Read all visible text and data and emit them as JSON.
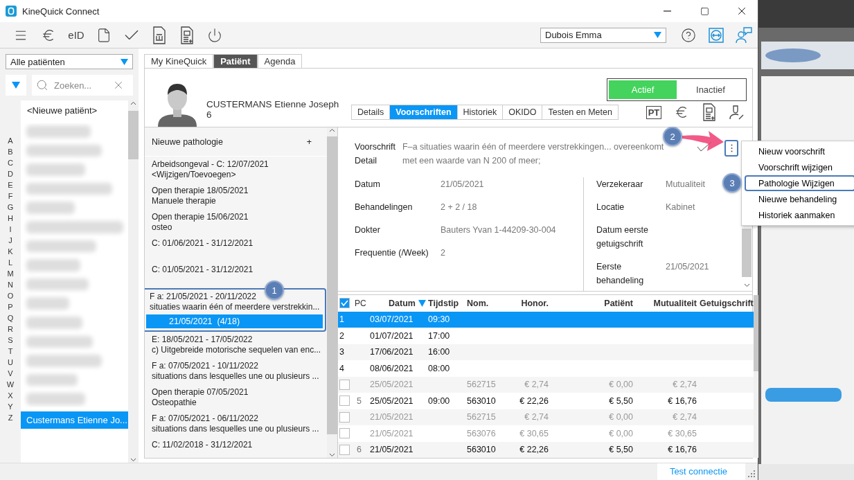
{
  "window": {
    "title": "KineQuick Connect"
  },
  "toolbar": {
    "eid_label": "eID",
    "user_select": {
      "value": "Dubois Emma"
    }
  },
  "sidebar": {
    "filter": {
      "value": "Alle patiënten"
    },
    "search": {
      "placeholder": "Zoeken..."
    },
    "letters": [
      "A",
      "B",
      "C",
      "D",
      "E",
      "F",
      "G",
      "H",
      "I",
      "J",
      "K",
      "L",
      "M",
      "N",
      "O",
      "P",
      "Q",
      "R",
      "S",
      "T",
      "U",
      "V",
      "W",
      "X",
      "Y",
      "Z"
    ],
    "new_patient": "<Nieuwe patiënt>",
    "patients": [
      {
        "name": "Custermans Etienne Jo...",
        "selected": true
      }
    ]
  },
  "main_tabs": [
    {
      "label": "My KineQuick",
      "selected": false
    },
    {
      "label": "Patiënt",
      "selected": true
    },
    {
      "label": "Agenda",
      "selected": false
    }
  ],
  "patient": {
    "name": "CUSTERMANS Etienne Joseph",
    "number": "6",
    "status": [
      {
        "label": "Actief",
        "selected": true
      },
      {
        "label": "Inactief",
        "selected": false
      }
    ],
    "sub_tabs": [
      {
        "label": "Details",
        "selected": false
      },
      {
        "label": "Voorschriften",
        "selected": true
      },
      {
        "label": "Historiek",
        "selected": false
      },
      {
        "label": "OKIDO",
        "selected": false
      },
      {
        "label": "Testen en Meten",
        "selected": false
      }
    ],
    "pt_label": "PT"
  },
  "pathologies": {
    "new_label": "Nieuwe pathologie",
    "add": "+",
    "items": [
      {
        "line1": "Arbeidsongeval - C: 12/07/2021",
        "line2": "<Wijzigen/Toevoegen>"
      },
      {
        "line1": "Open therapie 18/05/2021",
        "line2": "Manuele therapie"
      },
      {
        "line1": "Open therapie 15/06/2021",
        "line2": "osteo"
      },
      {
        "line1": "C: 01/06/2021 - 31/12/2021"
      },
      {
        "line1": "C: 01/05/2021 - 31/12/2021"
      },
      {
        "line1": "F a: 21/05/2021 - 20/11/2022",
        "line2": "situaties waarin één of meerdere verstrekkin...",
        "highlighted": true,
        "children": [
          {
            "label": "21/05/2021  (4/18)",
            "selected": true
          }
        ]
      },
      {
        "line1": "E: 18/05/2021 - 17/05/2022",
        "line2": "c) Uitgebreide motorische sequelen van enc..."
      },
      {
        "line1": "F a: 07/05/2021 - 10/11/2022",
        "line2": "situations dans lesquelles une ou plusieurs ..."
      },
      {
        "line1": "Open therapie 07/05/2021",
        "line2": "Osteopathie"
      },
      {
        "line1": "F a: 07/05/2021 - 06/11/2022",
        "line2": "situations dans lesquelles une ou plusieurs ..."
      },
      {
        "line1": "C: 11/02/2018 - 31/12/2021"
      }
    ]
  },
  "prescription": {
    "label": "Voorschrift",
    "label2": "Detail",
    "lines": [
      "F–a situaties waarin één of meerdere verstrekkingen... overeenkomt",
      "met een waarde van N 200 of meer;"
    ],
    "left_fields": [
      {
        "label": "Datum",
        "value": "21/05/2021"
      },
      {
        "label": "Behandelingen",
        "value": "2 + 2 / 18"
      },
      {
        "label": "Dokter",
        "value": "Bauters Yvan 1-44209-30-004"
      },
      {
        "label": "Frequentie (/Week)",
        "value": "2"
      }
    ],
    "right_fields": [
      {
        "label": "Verzekeraar",
        "value": "Mutualiteit"
      },
      {
        "label": "Locatie",
        "value": "Kabinet"
      },
      {
        "label": "Datum eerste getuigschrift"
      },
      {
        "label": "Eerste behandeling",
        "value": "21/05/2021"
      }
    ]
  },
  "menu": {
    "items": [
      {
        "label": "Nieuw voorschrift"
      },
      {
        "label": "Voorschrift wijzigen"
      },
      {
        "label": "Pathologie Wijzigen",
        "highlighted": true
      },
      {
        "label": "Nieuwe behandeling"
      },
      {
        "label": "Historiek aanmaken"
      }
    ]
  },
  "table": {
    "all_checked": true,
    "columns": [
      "PC",
      "Datum",
      "Tijdstip",
      "Nom.",
      "Honor.",
      "Patiënt",
      "Mutualiteit",
      "Getuigschrift"
    ],
    "rows": [
      {
        "kind": "appointment",
        "number": "1",
        "date": "03/07/2021",
        "time": "09:30",
        "selected": true
      },
      {
        "kind": "appointment",
        "number": "2",
        "date": "01/07/2021",
        "time": "17:00",
        "selected": false
      },
      {
        "kind": "appointment",
        "number": "3",
        "date": "17/06/2021",
        "time": "16:00",
        "selected": false
      },
      {
        "kind": "appointment",
        "number": "4",
        "date": "08/06/2021",
        "time": "08:00",
        "selected": false
      },
      {
        "kind": "billing",
        "checked": false,
        "disabled": true,
        "date": "25/05/2021",
        "nom": "562715",
        "honor": "€ 2,74",
        "patient": "€ 0,00",
        "mutualiteit": "€ 2,74",
        "selected": false
      },
      {
        "kind": "billing",
        "checked": false,
        "disabled": false,
        "number": "5",
        "date": "25/05/2021",
        "time": "09:00",
        "nom": "563010",
        "honor": "€ 22,26",
        "patient": "€ 5,50",
        "mutualiteit": "€ 16,76",
        "selected": false
      },
      {
        "kind": "billing",
        "checked": false,
        "disabled": true,
        "date": "21/05/2021",
        "nom": "562715",
        "honor": "€ 2,74",
        "patient": "€ 0,00",
        "mutualiteit": "€ 2,74",
        "selected": false
      },
      {
        "kind": "billing",
        "checked": false,
        "disabled": true,
        "date": "21/05/2021",
        "nom": "563076",
        "honor": "€ 30,65",
        "patient": "€ 0,00",
        "mutualiteit": "€ 30,65",
        "selected": false
      },
      {
        "kind": "billing",
        "checked": false,
        "disabled": false,
        "number": "6",
        "date": "21/05/2021",
        "nom": "563010",
        "honor": "€ 22,26",
        "patient": "€ 5,50",
        "mutualiteit": "€ 16,76",
        "selected": false
      }
    ]
  },
  "annotations": [
    {
      "label": "1"
    },
    {
      "label": "2"
    },
    {
      "label": "3"
    }
  ],
  "status_bar": {
    "link": "Test connectie"
  }
}
